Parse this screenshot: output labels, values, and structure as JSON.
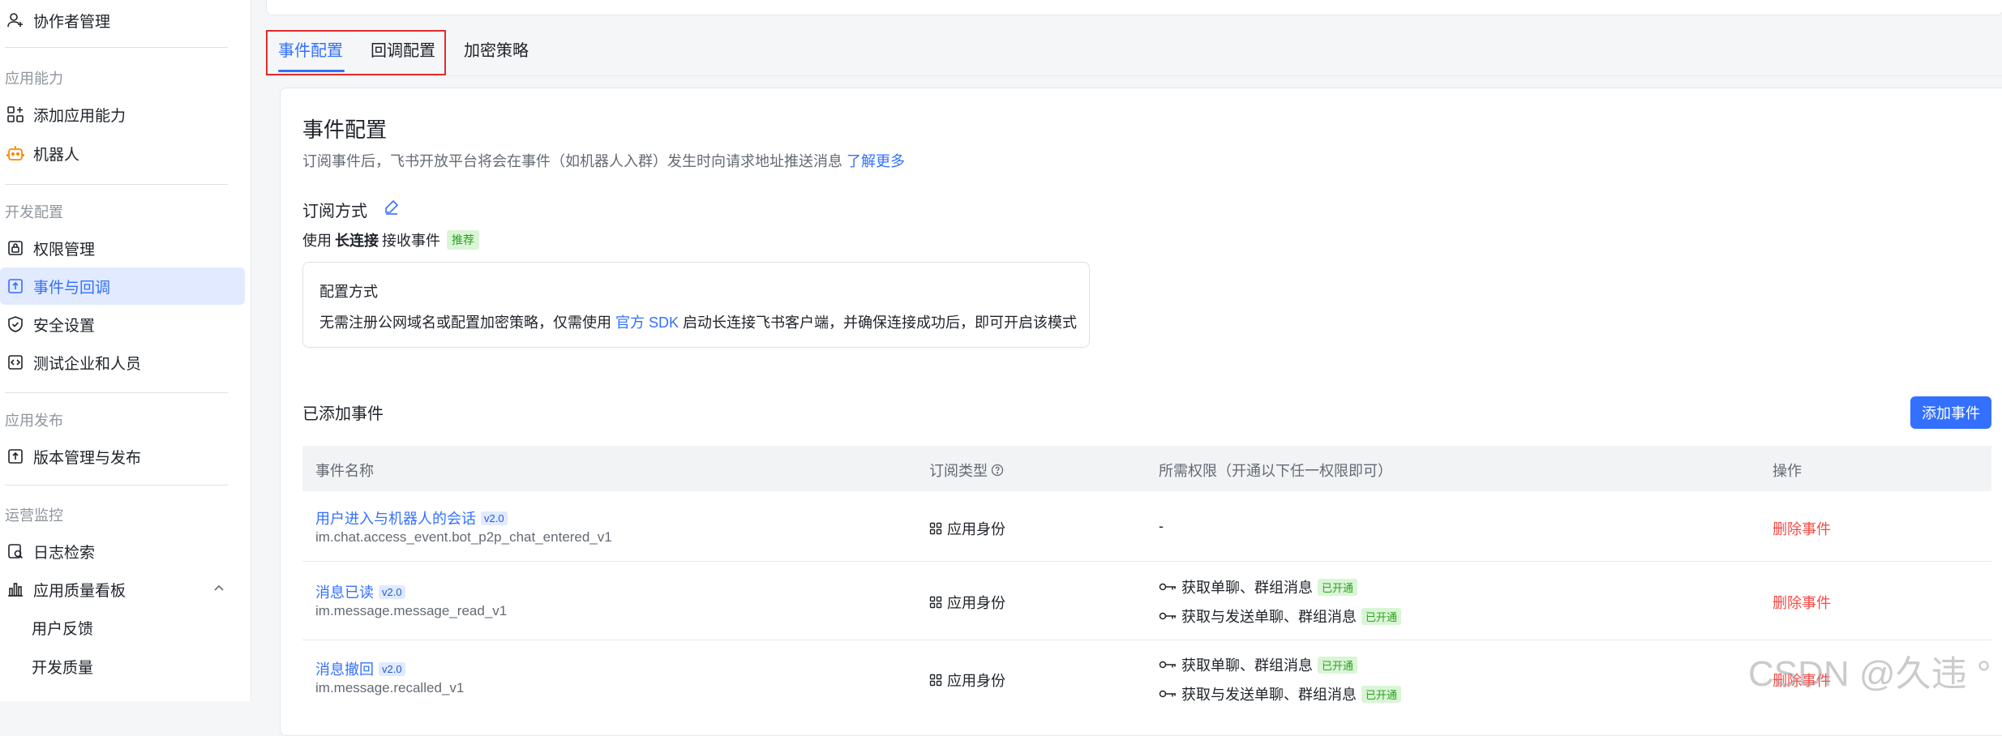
{
  "sidebar": {
    "top_item": "协作者管理",
    "groups": [
      {
        "title": "应用能力",
        "items": [
          "添加应用能力",
          "机器人"
        ]
      },
      {
        "title": "开发配置",
        "items": [
          "权限管理",
          "事件与回调",
          "安全设置",
          "测试企业和人员"
        ]
      },
      {
        "title": "应用发布",
        "items": [
          "版本管理与发布"
        ]
      },
      {
        "title": "运营监控",
        "items": [
          "日志检索",
          "应用质量看板",
          "用户反馈",
          "开发质量"
        ]
      }
    ],
    "active_item": "事件与回调"
  },
  "tabs": [
    "事件配置",
    "回调配置",
    "加密策略"
  ],
  "active_tab": "事件配置",
  "section": {
    "title": "事件配置",
    "desc": "订阅事件后，飞书开放平台将会在事件（如机器人入群）发生时向请求地址推送消息",
    "learn_more": "了解更多",
    "subscribe_label": "订阅方式",
    "use_prefix": "使用",
    "use_bold": "长连接",
    "use_suffix": "接收事件",
    "recommend": "推荐",
    "config_title": "配置方式",
    "config_text_1": "无需注册公网域名或配置加密策略，仅需使用",
    "config_link": "官方 SDK",
    "config_text_2": "启动长连接飞书客户端，并确保连接成功后，即可开启该模式"
  },
  "added": {
    "title": "已添加事件",
    "add_button": "添加事件"
  },
  "table": {
    "headers": [
      "事件名称",
      "订阅类型",
      "所需权限（开通以下任一权限即可）",
      "操作"
    ],
    "rows": [
      {
        "name": "用户进入与机器人的会话",
        "version": "v2.0",
        "key": "im.chat.access_event.bot_p2p_chat_entered_v1",
        "type": "应用身份",
        "permissions": [],
        "no_permission": "-",
        "action": "删除事件"
      },
      {
        "name": "消息已读",
        "version": "v2.0",
        "key": "im.message.message_read_v1",
        "type": "应用身份",
        "permissions": [
          {
            "label": "获取单聊、群组消息",
            "status": "已开通"
          },
          {
            "label": "获取与发送单聊、群组消息",
            "status": "已开通"
          }
        ],
        "action": "删除事件"
      },
      {
        "name": "消息撤回",
        "version": "v2.0",
        "key": "im.message.recalled_v1",
        "type": "应用身份",
        "permissions": [
          {
            "label": "获取单聊、群组消息",
            "status": "已开通"
          },
          {
            "label": "获取与发送单聊、群组消息",
            "status": "已开通"
          }
        ],
        "action": "删除事件"
      }
    ]
  },
  "watermark": "CSDN @久违 °",
  "colors": {
    "accent": "#3370ff",
    "danger": "#f54a45",
    "success": "#2ea121",
    "highlight_box": "#e12d2d"
  }
}
